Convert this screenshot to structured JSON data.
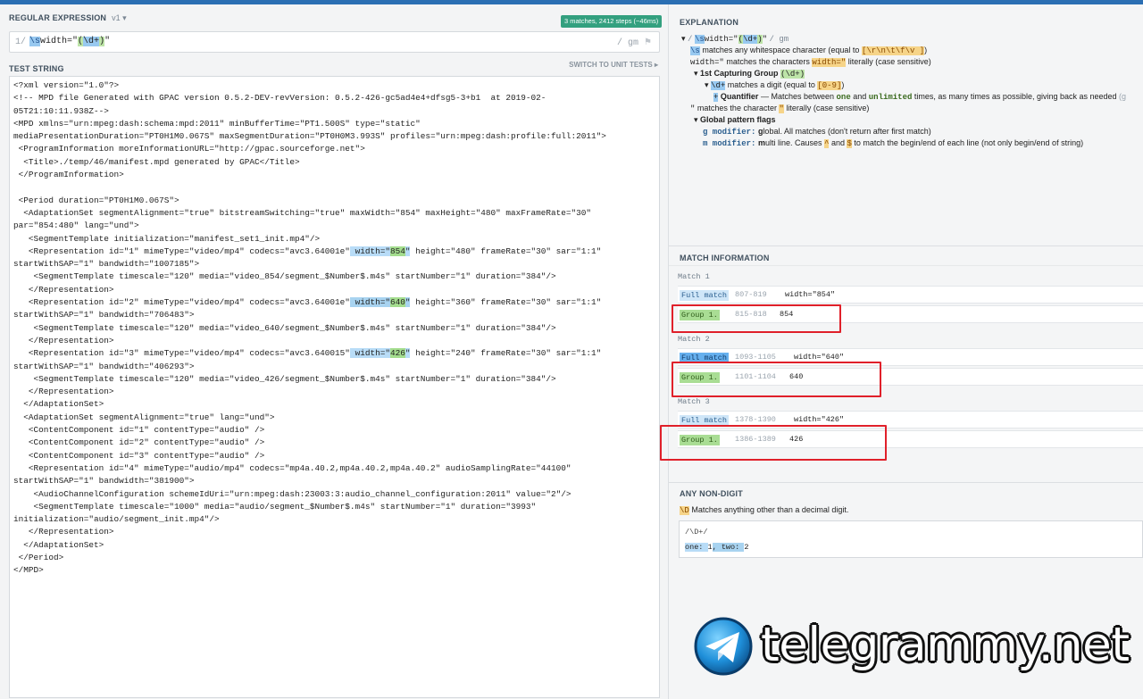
{
  "regex_panel": {
    "title": "REGULAR EXPRESSION",
    "flavor": "v1",
    "match_badge": "3 matches, 2412 steps (~46ms)",
    "delimiter_open": "1/",
    "pattern_parts": [
      "\\s",
      "width=\"",
      "(",
      "\\d+",
      ")",
      "\""
    ],
    "flags": "/ gm"
  },
  "test_string": {
    "title": "TEST STRING",
    "switch_label": "SWITCH TO UNIT TESTS",
    "lines": [
      "<?xml version=\"1.0\"?>",
      "<!-- MPD file Generated with GPAC version 0.5.2-DEV-revVersion: 0.5.2-426-gc5ad4e4+dfsg5-3+b1  at 2019-02-",
      "05T21:10:11.938Z-->",
      "<MPD xmlns=\"urn:mpeg:dash:schema:mpd:2011\" minBufferTime=\"PT1.500S\" type=\"static\"",
      "mediaPresentationDuration=\"PT0H1M0.067S\" maxSegmentDuration=\"PT0H0M3.993S\" profiles=\"urn:mpeg:dash:profile:full:2011\">",
      " <ProgramInformation moreInformationURL=\"http://gpac.sourceforge.net\">",
      "  <Title>./temp/46/manifest.mpd generated by GPAC</Title>",
      " </ProgramInformation>",
      "",
      " <Period duration=\"PT0H1M0.067S\">",
      "  <AdaptationSet segmentAlignment=\"true\" bitstreamSwitching=\"true\" maxWidth=\"854\" maxHeight=\"480\" maxFrameRate=\"30\"",
      "par=\"854:480\" lang=\"und\">",
      "   <SegmentTemplate initialization=\"manifest_set1_init.mp4\"/>",
      "   <Representation id=\"1\" mimeType=\"video/mp4\" codecs=\"avc3.64001e\"",
      "startWithSAP=\"1\" bandwidth=\"1007185\">",
      "    <SegmentTemplate timescale=\"120\" media=\"video_854/segment_$Number$.m4s\" startNumber=\"1\" duration=\"384\"/>",
      "   </Representation>",
      "   <Representation id=\"2\" mimeType=\"video/mp4\" codecs=\"avc3.64001e\"",
      "startWithSAP=\"1\" bandwidth=\"706483\">",
      "    <SegmentTemplate timescale=\"120\" media=\"video_640/segment_$Number$.m4s\" startNumber=\"1\" duration=\"384\"/>",
      "   </Representation>",
      "   <Representation id=\"3\" mimeType=\"video/mp4\" codecs=\"avc3.640015\"",
      "startWithSAP=\"1\" bandwidth=\"406293\">",
      "    <SegmentTemplate timescale=\"120\" media=\"video_426/segment_$Number$.m4s\" startNumber=\"1\" duration=\"384\"/>",
      "   </Representation>",
      "  </AdaptationSet>",
      "  <AdaptationSet segmentAlignment=\"true\" lang=\"und\">",
      "   <ContentComponent id=\"1\" contentType=\"audio\" />",
      "   <ContentComponent id=\"2\" contentType=\"audio\" />",
      "   <ContentComponent id=\"3\" contentType=\"audio\" />",
      "   <Representation id=\"4\" mimeType=\"audio/mp4\" codecs=\"mp4a.40.2,mp4a.40.2,mp4a.40.2\" audioSamplingRate=\"44100\"",
      "startWithSAP=\"1\" bandwidth=\"381900\">",
      "    <AudioChannelConfiguration schemeIdUri=\"urn:mpeg:dash:23003:3:audio_channel_configuration:2011\" value=\"2\"/>",
      "    <SegmentTemplate timescale=\"1000\" media=\"audio/segment_$Number$.m4s\" startNumber=\"1\" duration=\"3993\"",
      "initialization=\"audio/segment_init.mp4\"/>",
      "   </Representation>",
      "  </AdaptationSet>",
      " </Period>",
      "</MPD>"
    ],
    "matches": [
      {
        "before": " width=\"",
        "value": "854",
        "after": "\"",
        "tail": " height=\"480\" frameRate=\"30\" sar=\"1:1\""
      },
      {
        "before": " width=\"",
        "value": "640",
        "after": "\"",
        "tail": " height=\"360\" frameRate=\"30\" sar=\"1:1\""
      },
      {
        "before": " width=\"",
        "value": "426",
        "after": "\"",
        "tail": " height=\"240\" frameRate=\"30\" sar=\"1:1\""
      }
    ]
  },
  "explanation": {
    "title": "EXPLANATION",
    "root_prefix": "/",
    "root_suffix": "/ gm",
    "ws_desc_a": "matches any whitespace character (equal to",
    "ws_class": "[\\r\\n\\t\\f\\v ]",
    "ws_desc_b": ")",
    "lit_token": "width=\"",
    "lit_desc_a": "matches the characters",
    "lit_desc_b": "literally (case sensitive)",
    "group_label": "1st Capturing Group",
    "group_token": "(\\d+)",
    "digit_token": "\\d+",
    "digit_desc_a": "matches a digit (equal to",
    "digit_class": "[0-9]",
    "digit_desc_b": ")",
    "quant_token": "+",
    "quant_label": "Quantifier",
    "quant_desc_a": "— Matches between",
    "quant_one": "one",
    "quant_and": "and",
    "quant_unl": "unlimited",
    "quant_desc_b": "times, as many times as possible, giving back as needed",
    "quant_trail": "(g",
    "quote_token": "\"",
    "quote_desc_a": "matches the character",
    "quote_desc_b": "literally (case sensitive)",
    "flags_label": "Global pattern flags",
    "g_flag": "g modifier:",
    "g_bold": "g",
    "g_desc": "lobal. All matches (don't return after first match)",
    "m_flag": "m modifier:",
    "m_bold": "m",
    "m_desc_a": "ulti line. Causes",
    "caret": "^",
    "m_desc_and": "and",
    "dollar": "$",
    "m_desc_b": "to match the begin/end of each line (not only begin/end of string)"
  },
  "match_info": {
    "title": "MATCH INFORMATION",
    "matches": [
      {
        "label": "Match 1",
        "full_label": "Full match",
        "full_range": "807-819",
        "full_value": "width=\"854\"",
        "group_label": "Group 1.",
        "group_range": "815-818",
        "group_value": "854"
      },
      {
        "label": "Match 2",
        "full_label": "Full match",
        "full_range": "1093-1105",
        "full_value": "width=\"640\"",
        "group_label": "Group 1.",
        "group_range": "1101-1104",
        "group_value": "640"
      },
      {
        "label": "Match 3",
        "full_label": "Full match",
        "full_range": "1378-1390",
        "full_value": "width=\"426\"",
        "group_label": "Group 1.",
        "group_range": "1386-1389",
        "group_value": "426"
      }
    ]
  },
  "non_digit": {
    "title": "ANY NON-DIGIT",
    "token": "\\D",
    "desc": "Matches anything other than a decimal digit.",
    "example_regex": "/\\D+/",
    "example_a": "one: ",
    "example_b": "1",
    "example_c": ", two: ",
    "example_d": "2"
  },
  "watermark": {
    "text": "telegrammy.net",
    "icon": "telegram-plane-icon"
  },
  "colors": {
    "accent": "#2b6fb3",
    "match_badge": "#33a07f",
    "highlight_box": "#e0202a"
  }
}
